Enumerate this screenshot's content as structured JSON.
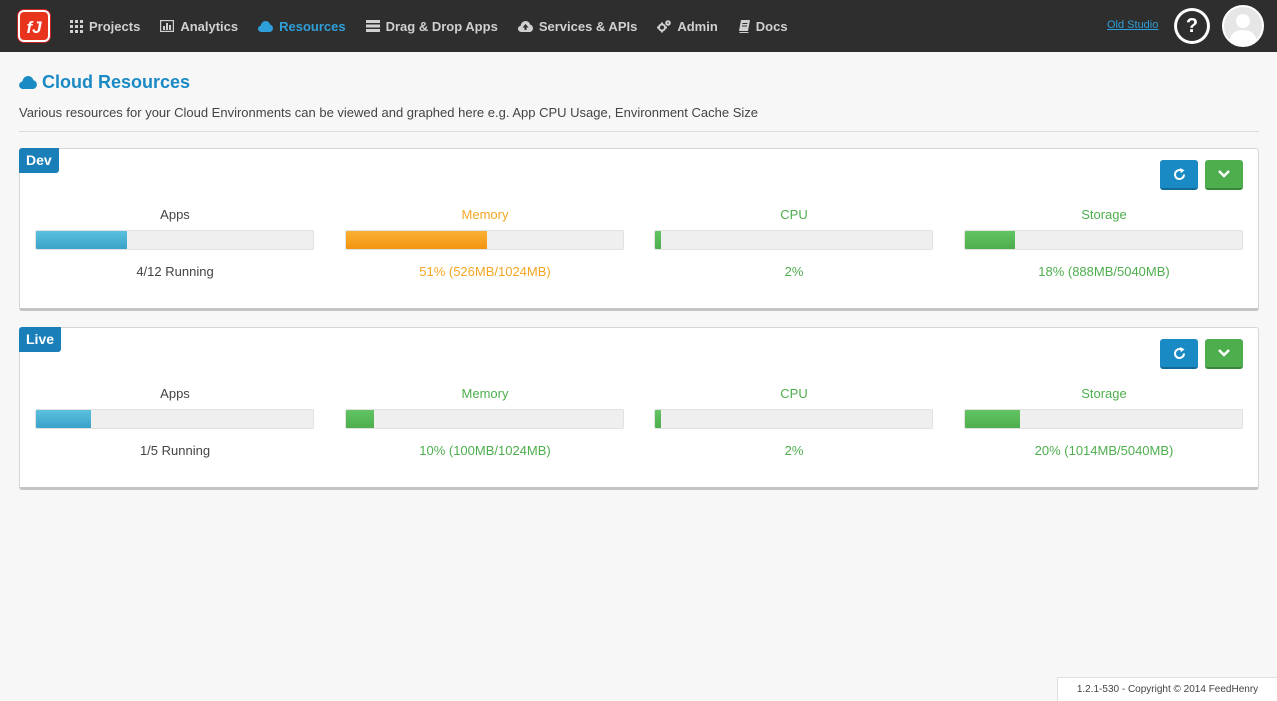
{
  "nav": {
    "logo_text": "fJ",
    "items": [
      {
        "label": "Projects",
        "icon": "grid-icon",
        "active": false
      },
      {
        "label": "Analytics",
        "icon": "bar-chart-icon",
        "active": false
      },
      {
        "label": "Resources",
        "icon": "cloud-icon",
        "active": true
      },
      {
        "label": "Drag & Drop Apps",
        "icon": "list-icon",
        "active": false
      },
      {
        "label": "Services & APIs",
        "icon": "cloud-upload-icon",
        "active": false
      },
      {
        "label": "Admin",
        "icon": "gears-icon",
        "active": false
      },
      {
        "label": "Docs",
        "icon": "book-icon",
        "active": false
      }
    ],
    "old_studio": "Old Studio",
    "help": "?"
  },
  "page": {
    "title": "Cloud Resources",
    "description": "Various resources for your Cloud Environments can be viewed and graphed here e.g. App CPU Usage, Environment Cache Size"
  },
  "environments": [
    {
      "name": "Dev",
      "metrics": [
        {
          "label": "Apps",
          "value": "4/12 Running",
          "percent": 33,
          "status": "info"
        },
        {
          "label": "Memory",
          "value": "51% (526MB/1024MB)",
          "percent": 51,
          "status": "warning"
        },
        {
          "label": "CPU",
          "value": "2%",
          "percent": 2,
          "status": "success"
        },
        {
          "label": "Storage",
          "value": "18% (888MB/5040MB)",
          "percent": 18,
          "status": "success"
        }
      ]
    },
    {
      "name": "Live",
      "metrics": [
        {
          "label": "Apps",
          "value": "1/5 Running",
          "percent": 20,
          "status": "info"
        },
        {
          "label": "Memory",
          "value": "10% (100MB/1024MB)",
          "percent": 10,
          "status": "success"
        },
        {
          "label": "CPU",
          "value": "2%",
          "percent": 2,
          "status": "success"
        },
        {
          "label": "Storage",
          "value": "20% (1014MB/5040MB)",
          "percent": 20,
          "status": "success"
        }
      ]
    }
  ],
  "colors": {
    "brand": "#e8341c",
    "accent": "#1a8ac4",
    "info": "#5bc0de",
    "warning": "#f5a623",
    "success": "#4eae4e"
  },
  "footer": {
    "text": "1.2.1-530 - Copyright © 2014 FeedHenry"
  }
}
